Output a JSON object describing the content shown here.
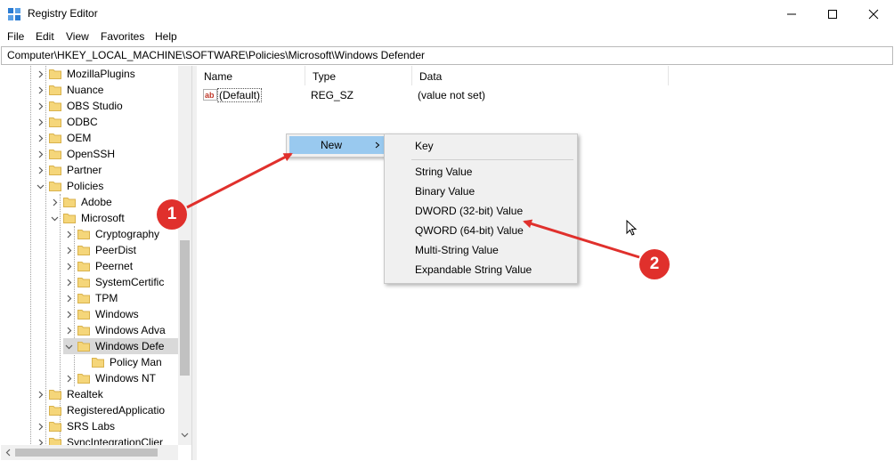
{
  "window": {
    "title": "Registry Editor"
  },
  "menu": [
    "File",
    "Edit",
    "View",
    "Favorites",
    "Help"
  ],
  "address": "Computer\\HKEY_LOCAL_MACHINE\\SOFTWARE\\Policies\\Microsoft\\Windows Defender",
  "tree": [
    "MozillaPlugins",
    "Nuance",
    "OBS Studio",
    "ODBC",
    "OEM",
    "OpenSSH",
    "Partner",
    "Policies",
    "Adobe",
    "Microsoft",
    "Cryptography",
    "PeerDist",
    "Peernet",
    "SystemCertific",
    "TPM",
    "Windows",
    "Windows Adva",
    "Windows Defe",
    "Policy Man",
    "Windows NT",
    "Realtek",
    "RegisteredApplicatio",
    "SRS Labs",
    "SyncIntegrationClier"
  ],
  "list": {
    "columns": [
      "Name",
      "Type",
      "Data"
    ],
    "rows": [
      {
        "name": "(Default)",
        "type": "REG_SZ",
        "data": "(value not set)",
        "icon": "string-value-icon"
      }
    ]
  },
  "context_menu": {
    "new_label": "New"
  },
  "submenu": {
    "key": "Key",
    "items": [
      "String Value",
      "Binary Value",
      "DWORD (32-bit) Value",
      "QWORD (64-bit) Value",
      "Multi-String Value",
      "Expandable String Value"
    ]
  },
  "annotations": {
    "badge1": "1",
    "badge2": "2",
    "color": "#e0302c"
  },
  "colors": {
    "highlight": "#99c9ef",
    "folder": "#f5d67a",
    "selected_row": "#d9d9d9"
  }
}
